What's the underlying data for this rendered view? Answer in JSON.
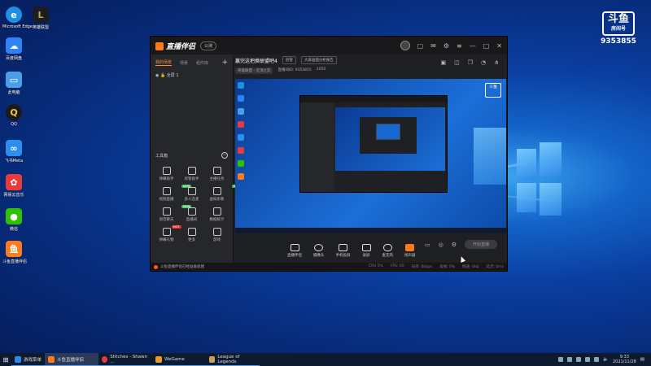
{
  "desktop": {
    "icons": [
      {
        "label": "Microsoft Edge",
        "icon": "edge-icon",
        "color": "#1f8ee6"
      },
      {
        "label": "英雄联盟",
        "icon": "lol-icon",
        "color": "#1c1c24"
      },
      {
        "label": "百度网盘",
        "icon": "baidu-netdisk-icon",
        "color": "#2e82f5"
      },
      {
        "label": "此电脑",
        "icon": "computer-icon",
        "color": "#4aa0e8"
      },
      {
        "label": "QQ",
        "icon": "qq-icon",
        "color": "#f3c72c"
      },
      {
        "label": "飞书Meta",
        "icon": "meta-icon",
        "color": "#2c8ef0"
      },
      {
        "label": "网易云音乐",
        "icon": "app-icon",
        "color": "#ea3b3b"
      },
      {
        "label": "微信",
        "icon": "wechat-icon",
        "color": "#2dc100"
      },
      {
        "label": "斗鱼直播伴侣",
        "icon": "douyu-icon",
        "color": "#ff7a1a"
      }
    ]
  },
  "watermark": {
    "brand": "斗鱼",
    "sub": "房间号",
    "room": "9353855"
  },
  "app": {
    "title": "直播伴侣",
    "beta_pill": "公测",
    "sidebar": {
      "tabs": [
        "我的场景",
        "场景",
        "组件库"
      ],
      "scene_name": "全屏 1",
      "tools_header": "工具箱",
      "tools": [
        {
          "label": "弹幕助手",
          "badge": ""
        },
        {
          "label": "房管助手",
          "badge": ""
        },
        {
          "label": "主播任务",
          "badge": ""
        },
        {
          "label": "视频直播",
          "badge": "NEW"
        },
        {
          "label": "多人连麦",
          "badge": ""
        },
        {
          "label": "虚拟形象",
          "badge": "NEW"
        },
        {
          "label": "语音聊天",
          "badge": "NEW"
        },
        {
          "label": "直播间",
          "badge": ""
        },
        {
          "label": "数据统计",
          "badge": ""
        },
        {
          "label": "弹幕礼物",
          "badge": "HOT"
        },
        {
          "label": "更多",
          "badge": ""
        },
        {
          "label": "游戏",
          "badge": ""
        }
      ]
    },
    "header": {
      "room_title": "赢完这把换联盟吧4",
      "tag1": "房管",
      "tag2": "大屏画面分析报告",
      "sub_chip": "英雄联盟 - 云顶之弈",
      "sub_meta": "直播间ID: 9353855",
      "sub_fans": "2050"
    },
    "preview_wm": "斗鱼",
    "controls": [
      {
        "label": "直播伴侣",
        "icon": "screen-share-icon"
      },
      {
        "label": "摄像头",
        "icon": "camera-icon"
      },
      {
        "label": "手机投屏",
        "icon": "phone-cast-icon"
      },
      {
        "label": "录屏",
        "icon": "record-icon"
      },
      {
        "label": "麦克风",
        "icon": "microphone-icon"
      },
      {
        "label": "扬声器",
        "icon": "speaker-icon"
      }
    ],
    "live_button": "开始直播",
    "status": {
      "message": "斗鱼直播伴侣已经准备就绪",
      "stats": [
        "CPU 3%",
        "FPS: 60",
        "码率: 0kbps",
        "丢帧: 0%",
        "网速: 0kb",
        "延迟: 0ms"
      ]
    }
  },
  "taskbar": {
    "buttons": [
      {
        "label": "游戏菜单",
        "color": "#2d8ae8",
        "active": false
      },
      {
        "label": "斗鱼直播伴侣",
        "color": "#ff7a1a",
        "active": true
      },
      {
        "label": "Stitches - Shawn ...",
        "color": "#e33b3b",
        "active": false
      },
      {
        "label": "WeGame",
        "color": "#e89a2a",
        "active": false
      },
      {
        "label": "League of Legends",
        "color": "#c8a24a",
        "active": false
      }
    ],
    "time": "9:33",
    "date": "2021/11/28"
  }
}
